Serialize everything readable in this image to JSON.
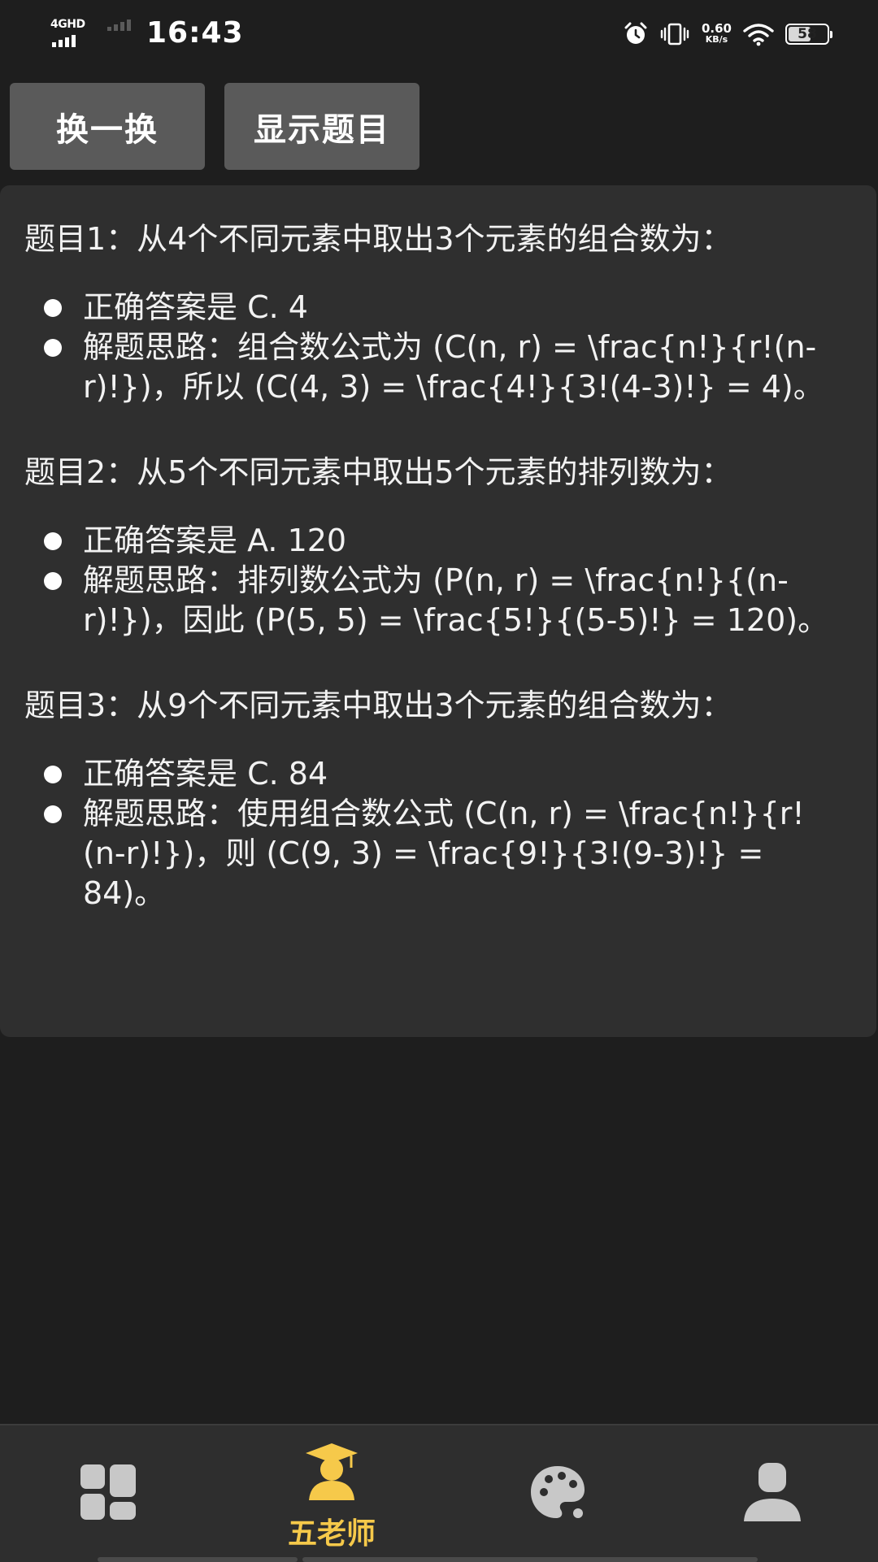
{
  "status_bar": {
    "network": "4GHD",
    "time": "16:43",
    "speed_value": "0.60",
    "speed_unit": "KB/s",
    "battery": "58",
    "battery_level": 0.58
  },
  "toolbar": {
    "switch_label": "换一换",
    "show_label": "显示题目"
  },
  "questions": [
    {
      "title": "题目1：从4个不同元素中取出3个元素的组合数为：",
      "answer": "正确答案是 C. 4",
      "explanation": "解题思路：组合数公式为 (C(n, r) = \\frac{n!}{r!(n-r)!})，所以 (C(4, 3) = \\frac{4!}{3!(4-3)!} = 4)。"
    },
    {
      "title": "题目2：从5个不同元素中取出5个元素的排列数为：",
      "answer": "正确答案是 A. 120",
      "explanation": "解题思路：排列数公式为 (P(n, r) = \\frac{n!}{(n-r)!})，因此 (P(5, 5) = \\frac{5!}{(5-5)!} = 120)。"
    },
    {
      "title": "题目3：从9个不同元素中取出3个元素的组合数为：",
      "answer": "正确答案是 C. 84",
      "explanation": "解题思路：使用组合数公式 (C(n, r) = \\frac{n!}{r!(n-r)!})，则 (C(9, 3) = \\frac{9!}{3!(9-3)!} = 84)。"
    }
  ],
  "bottom_nav": {
    "items": [
      {
        "icon": "grid-icon",
        "label": ""
      },
      {
        "icon": "graduation-cap-icon",
        "label": "五老师",
        "active": true
      },
      {
        "icon": "palette-icon",
        "label": ""
      },
      {
        "icon": "person-icon",
        "label": ""
      }
    ],
    "active_color": "#f6c94a"
  }
}
